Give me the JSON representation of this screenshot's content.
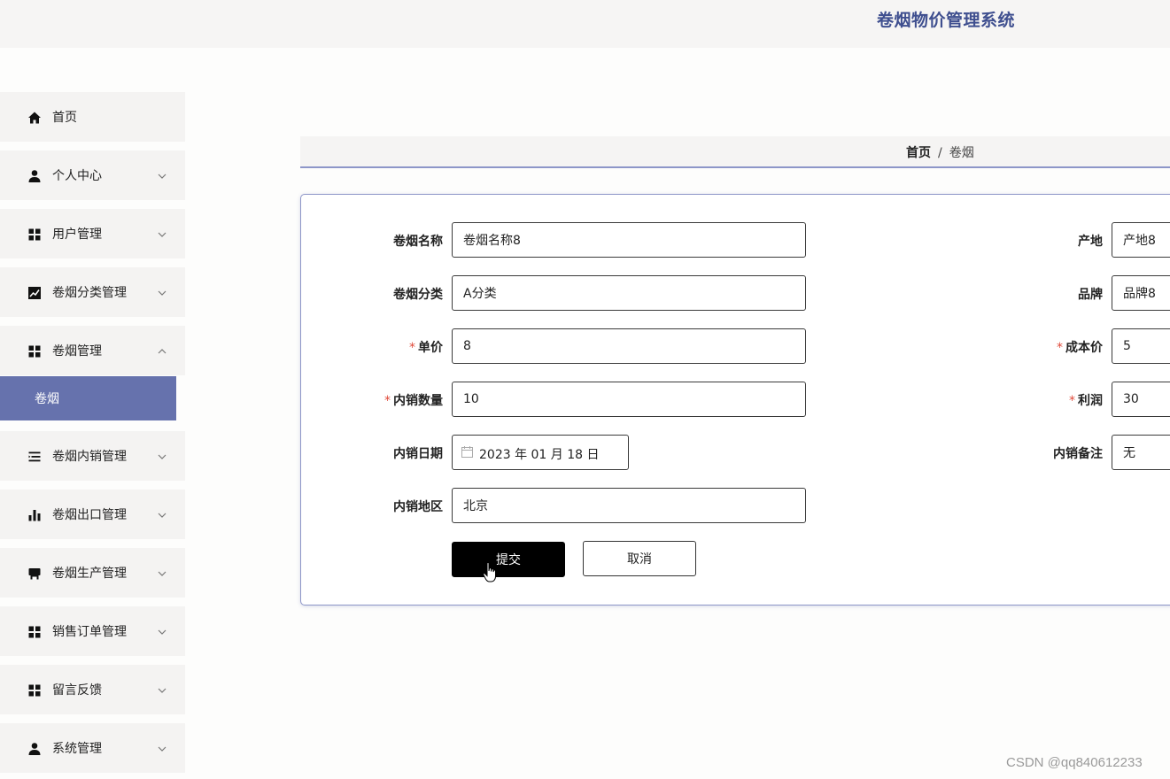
{
  "header": {
    "title": "卷烟物价管理系统"
  },
  "sidebar": {
    "items": [
      {
        "label": "首页",
        "icon": "home-icon"
      },
      {
        "label": "个人中心",
        "icon": "user-icon",
        "arrow": "chevron-down"
      },
      {
        "label": "用户管理",
        "icon": "grid-icon",
        "arrow": "chevron-down"
      },
      {
        "label": "卷烟分类管理",
        "icon": "chart-line-icon",
        "arrow": "chevron-down"
      },
      {
        "label": "卷烟管理",
        "icon": "grid-icon",
        "arrow": "chevron-up",
        "expanded": true
      },
      {
        "label": "卷烟内销管理",
        "icon": "list-icon",
        "arrow": "chevron-down"
      },
      {
        "label": "卷烟出口管理",
        "icon": "bar-chart-icon",
        "arrow": "chevron-down"
      },
      {
        "label": "卷烟生产管理",
        "icon": "store-icon",
        "arrow": "chevron-down"
      },
      {
        "label": "销售订单管理",
        "icon": "grid-icon",
        "arrow": "chevron-down"
      },
      {
        "label": "留言反馈",
        "icon": "grid-icon",
        "arrow": "chevron-down"
      },
      {
        "label": "系统管理",
        "icon": "user-icon",
        "arrow": "chevron-down"
      }
    ],
    "submenu": {
      "label": "卷烟",
      "active_color": "#6672ad"
    }
  },
  "breadcrumb": {
    "home": "首页",
    "separator": "/",
    "current": "卷烟"
  },
  "form": {
    "name": {
      "label": "卷烟名称",
      "value": "卷烟名称8"
    },
    "origin": {
      "label": "产地",
      "value": "产地8"
    },
    "category": {
      "label": "卷烟分类",
      "value": "A分类"
    },
    "brand": {
      "label": "品牌",
      "value": "品牌8"
    },
    "price": {
      "label": "单价",
      "value": "8",
      "required": true
    },
    "cost": {
      "label": "成本价",
      "value": "5",
      "required": true
    },
    "quantity": {
      "label": "内销数量",
      "value": "10",
      "required": true
    },
    "profit": {
      "label": "利润",
      "value": "30",
      "required": true
    },
    "date": {
      "label": "内销日期",
      "value": "2023 年 01 月 18 日"
    },
    "remark": {
      "label": "内销备注",
      "value": "无"
    },
    "region": {
      "label": "内销地区",
      "value": "北京"
    },
    "required_mark": "*",
    "submit_label": "提交",
    "cancel_label": "取消"
  },
  "watermark": "CSDN @qq840612233",
  "colors": {
    "title": "#3f4f8f",
    "accent": "#6672ad",
    "required": "#e04a3a",
    "submit_bg": "#000000"
  }
}
